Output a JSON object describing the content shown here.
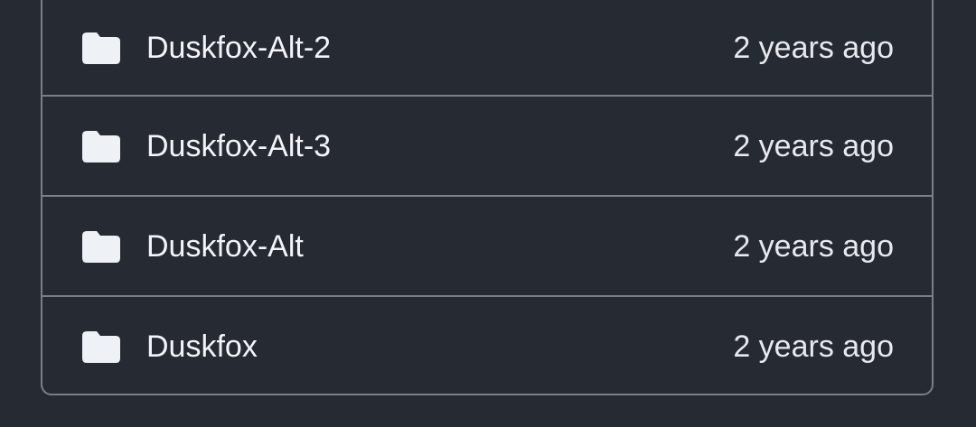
{
  "files": [
    {
      "name": "Duskfox-Alt-2",
      "type_icon": "folder-icon",
      "updated": "2 years ago"
    },
    {
      "name": "Duskfox-Alt-3",
      "type_icon": "folder-icon",
      "updated": "2 years ago"
    },
    {
      "name": "Duskfox-Alt",
      "type_icon": "folder-icon",
      "updated": "2 years ago"
    },
    {
      "name": "Duskfox",
      "type_icon": "folder-icon",
      "updated": "2 years ago"
    }
  ],
  "colors": {
    "background": "#262a33",
    "border": "#7a7f8c",
    "text": "#f2f4f8",
    "folder_icon": "#eef2f7"
  }
}
